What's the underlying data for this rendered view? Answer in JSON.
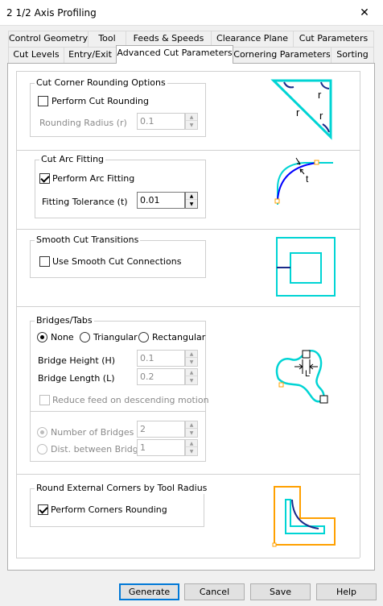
{
  "window": {
    "title": "2 1/2 Axis Profiling",
    "close_glyph": "✕"
  },
  "tabs_row1": [
    "Control Geometry",
    "Tool",
    "Feeds & Speeds",
    "Clearance Plane",
    "Cut Parameters"
  ],
  "tabs_row2": [
    "Cut Levels",
    "Entry/Exit",
    "Advanced Cut Parameters",
    "Cornering Parameters",
    "Sorting"
  ],
  "active_tab": "Advanced Cut Parameters",
  "corner_rounding": {
    "title": "Cut Corner Rounding Options",
    "perform_label": "Perform Cut Rounding",
    "perform_checked": false,
    "radius_label": "Rounding Radius (r)",
    "radius_value": "0.1",
    "illus_label": "r"
  },
  "arc_fitting": {
    "title": "Cut Arc Fitting",
    "perform_label": "Perform Arc Fitting",
    "perform_checked": true,
    "tolerance_label": "Fitting Tolerance (t)",
    "tolerance_value": "0.01",
    "illus_label": "t"
  },
  "smooth": {
    "title": "Smooth Cut Transitions",
    "use_label": "Use Smooth Cut Connections",
    "use_checked": false
  },
  "bridges": {
    "title": "Bridges/Tabs",
    "type_options": [
      "None",
      "Triangular",
      "Rectangular"
    ],
    "selected_type": "None",
    "height_label": "Bridge Height (H)",
    "height_value": "0.1",
    "length_label": "Bridge Length (L)",
    "length_value": "0.2",
    "reduce_label": "Reduce feed on descending motion",
    "reduce_checked": false,
    "number_label": "Number of Bridges",
    "number_value": "2",
    "dist_label": "Dist. between Bridges",
    "dist_value": "1",
    "illus_label": "L"
  },
  "external_corners": {
    "title": "Round External Corners by Tool Radius",
    "perform_label": "Perform Corners Rounding",
    "perform_checked": true
  },
  "buttons": {
    "generate": "Generate",
    "cancel": "Cancel",
    "save": "Save",
    "help": "Help"
  },
  "colors": {
    "accent": "#0078d7",
    "cyan": "#00d4d4",
    "blue": "#0000ff",
    "orange": "#ffa000",
    "navy": "#1a2a8a"
  }
}
